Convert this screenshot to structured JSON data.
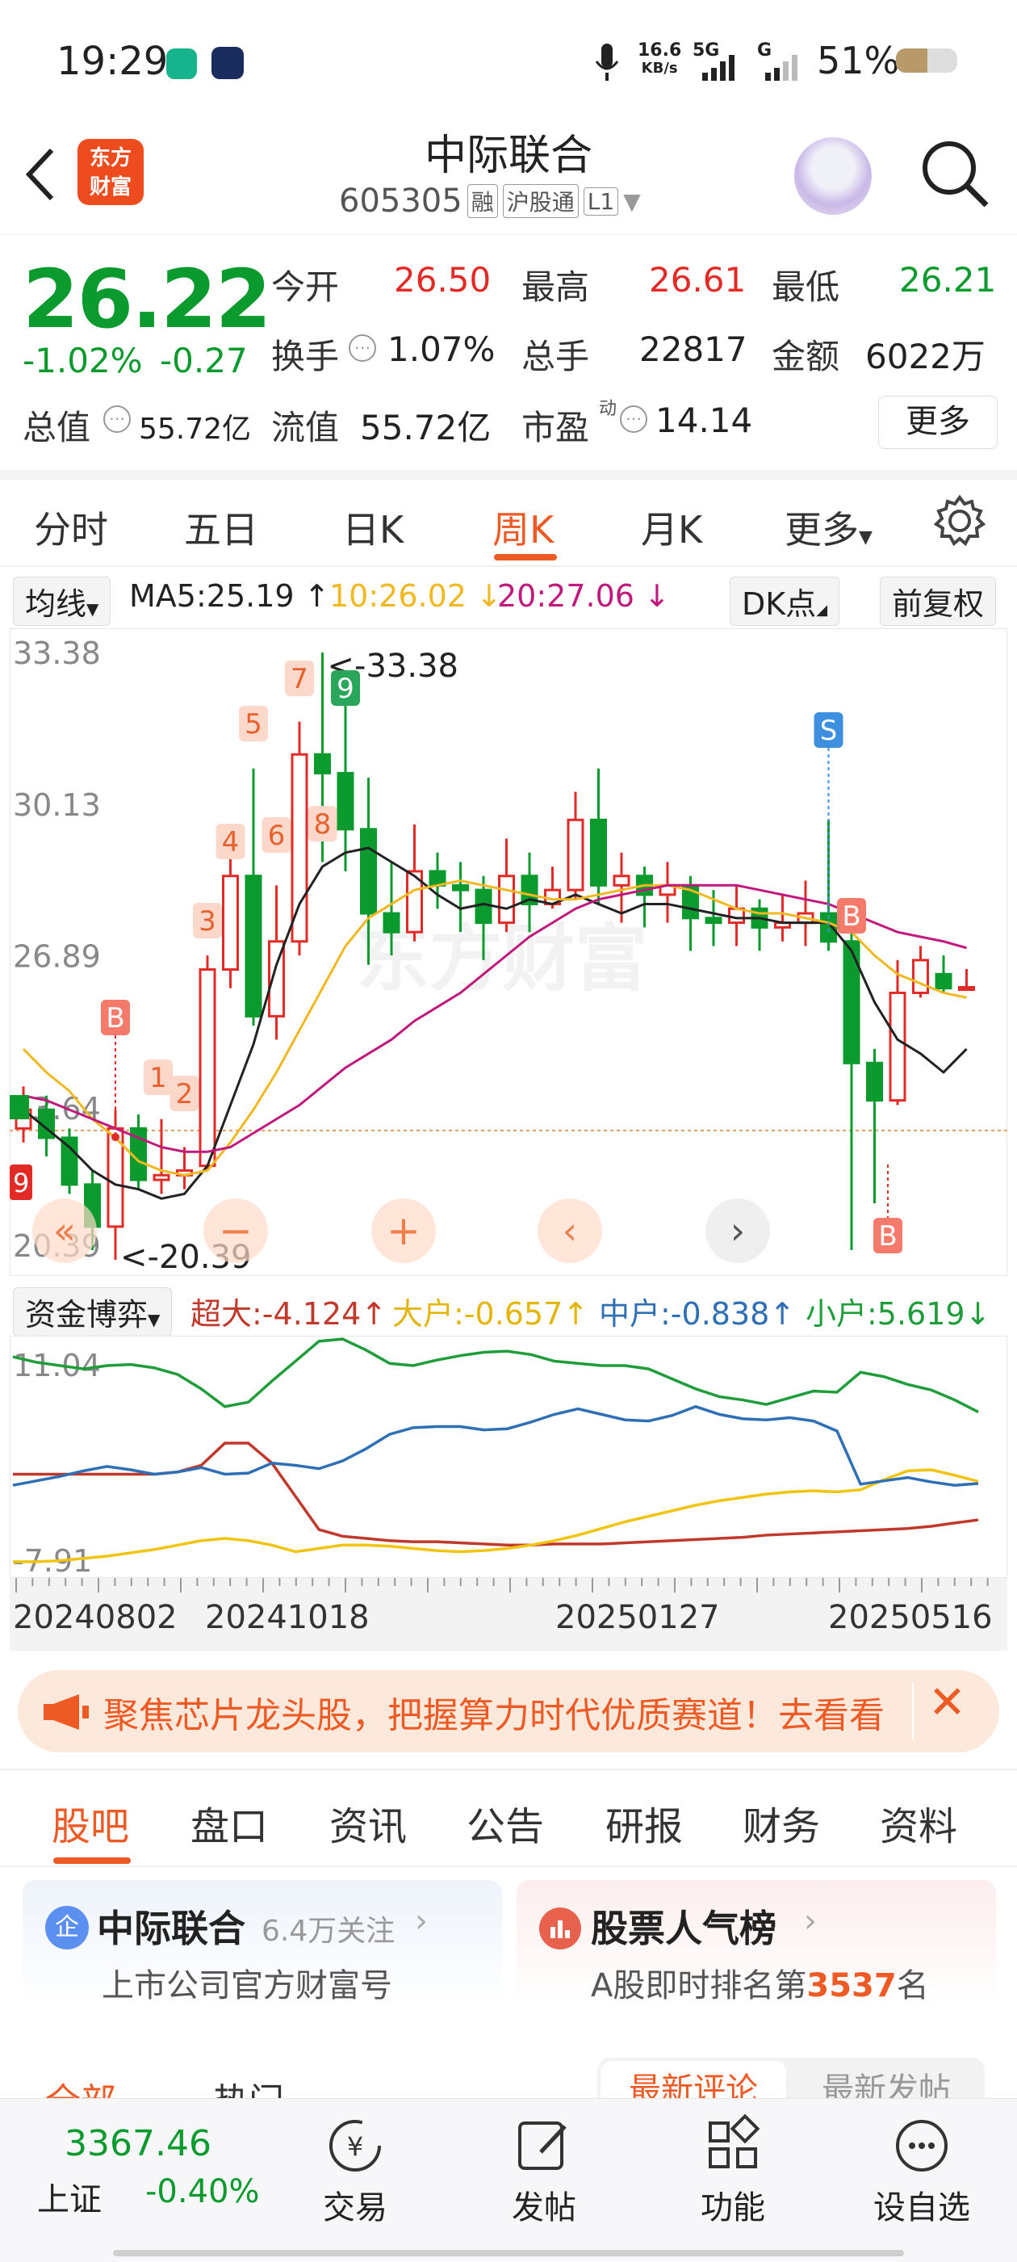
{
  "status_bar": {
    "time": "19:29",
    "net_speed_value": "16.6",
    "net_speed_unit": "KB/s",
    "net_5g": "5G",
    "net_g": "G",
    "battery": "51%"
  },
  "header": {
    "app_logo_line1": "东方",
    "app_logo_line2": "财富",
    "stock_name": "中际联合",
    "stock_code": "605305",
    "badge_rong": "融",
    "badge_hgt": "沪股通",
    "badge_l1": "L1"
  },
  "quote": {
    "price": "26.22",
    "change_pct": "-1.02%",
    "change_amt": "-0.27",
    "open_label": "今开",
    "open": "26.50",
    "high_label": "最高",
    "high": "26.61",
    "low_label": "最低",
    "low": "26.21",
    "turnover_label": "换手",
    "turnover": "1.07%",
    "volume_label": "总手",
    "volume": "22817",
    "amount_label": "金额",
    "amount": "6022万",
    "mktcap_label": "总值",
    "mktcap": "55.72亿",
    "float_label": "流值",
    "float": "55.72亿",
    "pe_label": "市盈",
    "pe_sup": "动",
    "pe": "14.14",
    "more_button": "更多"
  },
  "chart_tabs": [
    "分时",
    "五日",
    "日K",
    "周K",
    "月K",
    "更多"
  ],
  "active_chart_tab": 3,
  "indicator_bar": {
    "ma_selector": "均线",
    "ma5": "MA5:25.19 ↑",
    "ma10": "10:26.02 ↓",
    "ma20": "20:27.06 ↓",
    "dk_button": "DK点",
    "adjust_button": "前复权"
  },
  "main_chart_labels": {
    "y_ticks": [
      "33.38",
      "30.13",
      "26.89",
      "23.64",
      "20.39"
    ],
    "max_label": "<-33.38",
    "min_label": "<-20.39",
    "markers": [
      "B",
      "S",
      "B",
      "B",
      "1",
      "2",
      "3",
      "4",
      "5",
      "6",
      "7",
      "8",
      "9",
      "9"
    ],
    "left_marker": "9"
  },
  "chart_data": [
    {
      "type": "candlestick",
      "title": "",
      "ylim": [
        20.39,
        33.38
      ],
      "y_ticks": [
        33.38,
        30.13,
        26.89,
        23.64,
        20.39
      ],
      "series": [
        {
          "name": "K",
          "candles": [
            [
              23.2,
              23.6,
              22.9,
              24.1
            ],
            [
              23.6,
              23.0,
              22.6,
              23.9
            ],
            [
              23.0,
              22.0,
              21.8,
              23.2
            ],
            [
              22.0,
              21.1,
              20.6,
              22.3
            ],
            [
              21.1,
              23.2,
              20.39,
              23.6
            ],
            [
              23.2,
              22.1,
              21.9,
              23.5
            ],
            [
              22.1,
              22.2,
              21.8,
              23.4
            ],
            [
              22.2,
              22.3,
              21.9,
              22.8
            ],
            [
              22.4,
              26.6,
              22.3,
              26.9
            ],
            [
              26.6,
              28.6,
              26.2,
              29.0
            ],
            [
              28.6,
              25.6,
              25.4,
              30.9
            ],
            [
              25.6,
              27.2,
              25.1,
              28.4
            ],
            [
              27.2,
              31.2,
              26.9,
              31.9
            ],
            [
              31.2,
              30.8,
              28.9,
              33.38
            ],
            [
              30.8,
              29.6,
              28.7,
              32.3
            ],
            [
              29.6,
              27.8,
              26.7,
              30.7
            ],
            [
              27.8,
              27.4,
              26.9,
              28.9
            ],
            [
              27.4,
              28.7,
              27.2,
              29.7
            ],
            [
              28.7,
              28.4,
              27.9,
              29.1
            ],
            [
              28.4,
              28.3,
              27.4,
              28.9
            ],
            [
              28.3,
              27.6,
              26.8,
              28.6
            ],
            [
              27.6,
              28.6,
              27.4,
              29.4
            ],
            [
              28.6,
              28.0,
              27.4,
              29.1
            ],
            [
              28.0,
              28.3,
              27.9,
              28.8
            ],
            [
              28.3,
              29.8,
              28.1,
              30.4
            ],
            [
              29.8,
              28.4,
              28.0,
              30.9
            ],
            [
              28.4,
              28.6,
              27.6,
              29.1
            ],
            [
              28.6,
              28.2,
              27.5,
              28.8
            ],
            [
              28.2,
              28.4,
              27.6,
              28.9
            ],
            [
              28.4,
              27.7,
              27.0,
              28.6
            ],
            [
              27.7,
              27.6,
              27.1,
              28.3
            ],
            [
              27.6,
              27.9,
              27.1,
              28.4
            ],
            [
              27.9,
              27.5,
              27.0,
              28.1
            ],
            [
              27.5,
              27.6,
              27.2,
              28.2
            ],
            [
              27.6,
              27.8,
              27.1,
              28.5
            ],
            [
              27.8,
              27.2,
              27.0,
              29.8
            ],
            [
              27.2,
              24.6,
              20.6,
              27.4
            ],
            [
              24.6,
              23.8,
              21.6,
              24.9
            ],
            [
              23.8,
              26.1,
              23.7,
              26.8
            ],
            [
              26.1,
              26.8,
              26.0,
              27.1
            ],
            [
              26.5,
              26.2,
              26.1,
              26.9
            ],
            [
              26.2,
              26.22,
              26.21,
              26.61
            ]
          ]
        },
        {
          "name": "MA5",
          "values": [
            23.6,
            23.2,
            22.8,
            22.3,
            22.0,
            21.9,
            21.7,
            21.8,
            22.4,
            23.7,
            25.0,
            26.7,
            28.0,
            28.8,
            29.1,
            29.2,
            28.9,
            28.6,
            28.2,
            27.9,
            28.0,
            27.9,
            28.1,
            28.0,
            28.2,
            28.0,
            27.8,
            28.0,
            28.0,
            27.9,
            27.8,
            27.7,
            27.7,
            27.6,
            27.6,
            27.6,
            27.0,
            25.9,
            25.1,
            24.8,
            24.4,
            24.9
          ]
        },
        {
          "name": "MA10",
          "values": [
            24.9,
            24.4,
            24.0,
            23.4,
            23.0,
            22.5,
            22.3,
            22.2,
            22.3,
            22.9,
            23.6,
            24.4,
            25.3,
            26.2,
            27.1,
            27.7,
            28.0,
            28.3,
            28.4,
            28.5,
            28.4,
            28.3,
            28.2,
            28.1,
            28.1,
            28.2,
            28.3,
            28.4,
            28.4,
            28.3,
            28.1,
            27.9,
            27.8,
            27.8,
            27.7,
            27.6,
            27.4,
            26.9,
            26.5,
            26.3,
            26.1,
            26.0
          ]
        },
        {
          "name": "MA20",
          "values": [
            23.9,
            23.8,
            23.6,
            23.4,
            23.2,
            23.0,
            22.8,
            22.7,
            22.7,
            22.8,
            23.1,
            23.4,
            23.7,
            24.1,
            24.5,
            24.8,
            25.1,
            25.5,
            25.8,
            26.1,
            26.5,
            26.9,
            27.3,
            27.6,
            27.9,
            28.1,
            28.2,
            28.3,
            28.4,
            28.4,
            28.4,
            28.4,
            28.3,
            28.2,
            28.1,
            28.0,
            27.8,
            27.6,
            27.4,
            27.3,
            27.2,
            27.06
          ]
        }
      ]
    },
    {
      "type": "line",
      "title": "",
      "ylim": [
        -7.91,
        11.04
      ],
      "y_ticks": [
        11.04,
        -7.91
      ],
      "x_ticks": [
        "20240802",
        "20241018",
        "20250127",
        "20250516"
      ],
      "series": [
        {
          "name": "超大",
          "values": [
            0.0,
            0.0,
            0.0,
            0.0,
            0.0,
            0.0,
            0.0,
            0.2,
            0.8,
            2.8,
            2.8,
            1.0,
            -2.0,
            -5.0,
            -5.6,
            -5.8,
            -6.0,
            -6.1,
            -6.1,
            -6.2,
            -6.3,
            -6.4,
            -6.4,
            -6.3,
            -6.3,
            -6.3,
            -6.2,
            -6.1,
            -6.0,
            -5.9,
            -5.8,
            -5.7,
            -5.5,
            -5.4,
            -5.3,
            -5.2,
            -5.1,
            -5.0,
            -4.9,
            -4.7,
            -4.4,
            -4.124
          ]
        },
        {
          "name": "大户",
          "values": [
            -7.9,
            -7.9,
            -7.8,
            -7.6,
            -7.4,
            -7.1,
            -6.8,
            -6.4,
            -6.0,
            -5.8,
            -6.0,
            -6.4,
            -7.0,
            -6.7,
            -6.4,
            -6.4,
            -6.5,
            -6.7,
            -6.9,
            -7.0,
            -6.9,
            -6.7,
            -6.4,
            -6.0,
            -5.5,
            -4.9,
            -4.3,
            -3.8,
            -3.3,
            -2.8,
            -2.4,
            -2.1,
            -1.8,
            -1.6,
            -1.5,
            -1.6,
            -1.4,
            -0.5,
            0.3,
            0.4,
            -0.1,
            -0.657
          ]
        },
        {
          "name": "中户",
          "values": [
            -1.0,
            -0.6,
            -0.2,
            0.3,
            0.7,
            0.4,
            0.0,
            0.2,
            0.6,
            0.0,
            0.1,
            1.0,
            0.8,
            0.5,
            1.2,
            2.3,
            3.6,
            4.2,
            4.3,
            4.3,
            4.0,
            4.1,
            4.7,
            5.4,
            5.9,
            5.4,
            4.9,
            4.8,
            5.3,
            6.1,
            5.4,
            5.0,
            4.9,
            5.1,
            4.8,
            3.9,
            -0.9,
            -0.6,
            -0.3,
            -0.7,
            -1.0,
            -0.838
          ]
        },
        {
          "name": "小户",
          "values": [
            10.6,
            10.1,
            9.8,
            9.5,
            9.8,
            9.9,
            9.6,
            9.0,
            7.7,
            6.1,
            6.5,
            8.4,
            10.2,
            12.0,
            12.2,
            11.2,
            10.0,
            9.8,
            10.3,
            10.7,
            11.0,
            11.1,
            10.8,
            10.2,
            10.0,
            9.8,
            9.8,
            9.5,
            8.6,
            7.7,
            7.0,
            6.7,
            6.3,
            6.9,
            7.5,
            7.4,
            9.2,
            8.8,
            8.1,
            7.6,
            6.7,
            5.619
          ]
        }
      ]
    }
  ],
  "flow_bar": {
    "selector": "资金博弈",
    "super": "超大:-4.124↑",
    "large": "大户:-0.657↑",
    "medium": "中户:-0.838↑",
    "small": "小户:5.619↓"
  },
  "banner": {
    "text": "聚焦芯片龙头股，把握算力时代优质赛道！去看看",
    "close": "✕"
  },
  "section_tabs": [
    "股吧",
    "盘口",
    "资讯",
    "公告",
    "研报",
    "财务",
    "资料"
  ],
  "active_section_tab": 0,
  "cards": {
    "company_badge": "企",
    "company_name": "中际联合",
    "company_follow": "6.4万关注",
    "company_sub": "上市公司官方财富号",
    "rank_title": "股票人气榜",
    "rank_prefix": "A股即时排名第",
    "rank_num": "3537",
    "rank_suffix": "名"
  },
  "sub_tabs": {
    "all": "全部",
    "hot": "热门",
    "latest_comment": "最新评论",
    "latest_post": "最新发帖"
  },
  "bottom_bar": {
    "index_value": "3367.46",
    "index_name": "上证",
    "index_change": "-0.40%",
    "trade": "交易",
    "post": "发帖",
    "func": "功能",
    "watch": "设自选"
  },
  "colors": {
    "red": "#e22b26",
    "green": "#0a9a2d",
    "ma5": "#222222",
    "ma10": "#f1b821",
    "ma20": "#c0197e",
    "super": "#c0392b",
    "large": "#f1c40f",
    "medium": "#2e6fb5",
    "small": "#1f9d3a",
    "accent": "#ee5a24"
  }
}
